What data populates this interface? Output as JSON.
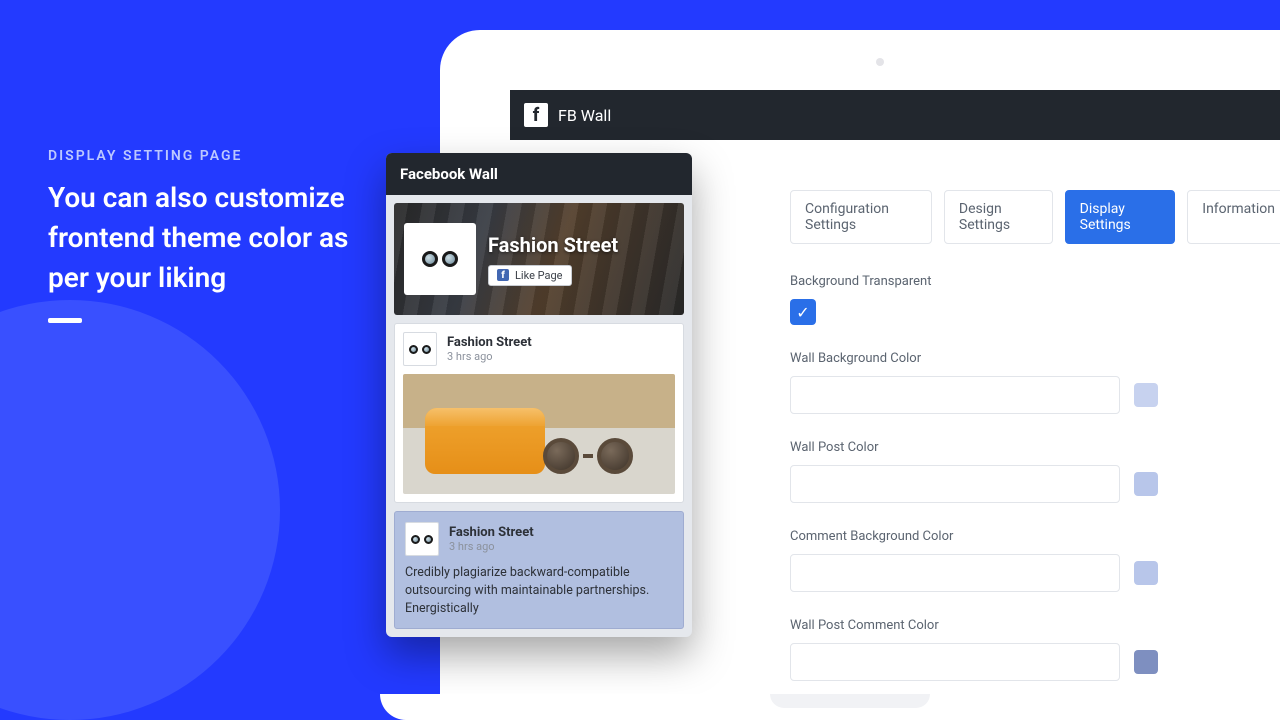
{
  "hero": {
    "eyebrow": "DISPLAY SETTING PAGE",
    "title": "You can also customize frontend theme color as per your liking"
  },
  "app": {
    "title": "FB Wall",
    "logo_letter": "f"
  },
  "tabs": [
    {
      "label": "Configuration Settings",
      "active": false
    },
    {
      "label": "Design Settings",
      "active": false
    },
    {
      "label": "Display Settings",
      "active": true
    },
    {
      "label": "Information",
      "active": false
    }
  ],
  "settings": {
    "bg_transparent": {
      "label": "Background Transparent",
      "checked": true
    },
    "wall_bg": {
      "label": "Wall Background Color",
      "swatch": "#c7d2ef"
    },
    "wall_post": {
      "label": "Wall Post Color",
      "swatch": "#b8c6ea"
    },
    "comment_bg": {
      "label": "Comment Background Color",
      "swatch": "#b8c6ea"
    },
    "wall_comment": {
      "label": "Wall Post Comment Color",
      "swatch": "#7e8fc0"
    }
  },
  "preview": {
    "panel_title": "Facebook Wall",
    "page_name": "Fashion Street",
    "like_label": "Like Page",
    "posts": [
      {
        "author": "Fashion Street",
        "time": "3 hrs ago"
      },
      {
        "author": "Fashion Street",
        "time": "3 hrs ago",
        "text": "Credibly plagiarize backward-compatible outsourcing with maintainable partnerships. Energistically"
      }
    ]
  }
}
